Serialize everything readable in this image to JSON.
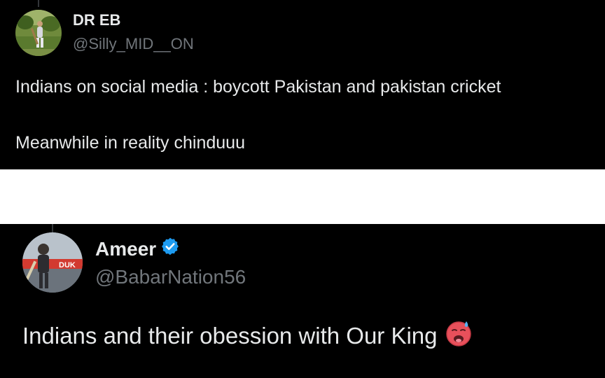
{
  "colors": {
    "background": "#000000",
    "text_primary": "#e7e9ea",
    "text_secondary": "#71767b",
    "separator": "#ffffff",
    "verified_badge": "#1d9bf0"
  },
  "tweets": [
    {
      "display_name": "DR EB",
      "handle": "@Silly_MID__ON",
      "verified": false,
      "lines": [
        "Indians on social media : boycott Pakistan and pakistan cricket",
        "Meanwhile in reality chinduuu"
      ]
    },
    {
      "display_name": "Ameer",
      "handle": "@BabarNation56",
      "verified": true,
      "verified_icon": "verified-badge-icon",
      "lines": [
        "Indians and their obession with Our King"
      ],
      "emoji": "hot-face-emoji"
    }
  ]
}
